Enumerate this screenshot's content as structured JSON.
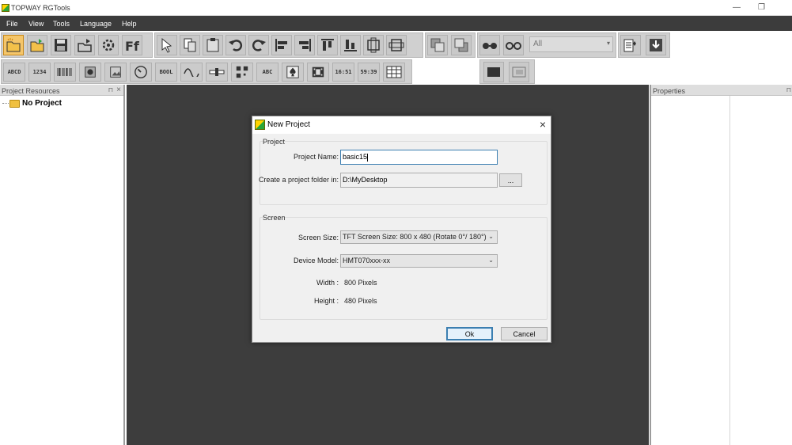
{
  "app": {
    "title": "TOPWAY RGTools",
    "window_controls": {
      "minimize": "—",
      "restore": "❐"
    }
  },
  "menu": [
    {
      "label": "File"
    },
    {
      "label": "View"
    },
    {
      "label": "Tools"
    },
    {
      "label": "Language"
    },
    {
      "label": "Help"
    }
  ],
  "toolbar": {
    "layer_combo_value": "All",
    "small_button_labels": [
      "ABCD",
      "1234",
      "BOOL",
      "16:51",
      "59:39",
      "ABC"
    ]
  },
  "left_panel": {
    "title": "Project Resources",
    "pin": "⊓",
    "close": "×",
    "tree_root": "No Project"
  },
  "right_panel": {
    "title": "Properties",
    "pin": "⊓"
  },
  "dialog": {
    "title": "New Project",
    "close": "×",
    "project_group": "Project",
    "project_name_label": "Project Name:",
    "project_name_value": "basic15",
    "folder_label": "Create a project folder in:",
    "folder_value": "D:\\MyDesktop",
    "browse_label": "...",
    "screen_group": "Screen",
    "screen_size_label": "Screen Size:",
    "screen_size_value": "TFT Screen Size: 800 x 480 (Rotate 0°/ 180°)",
    "device_model_label": "Device Model:",
    "device_model_value": "HMT070xxx-xx",
    "width_label": "Width :",
    "width_value": "800 Pixels",
    "height_label": "Height :",
    "height_value": "480 Pixels",
    "ok_label": "Ok",
    "cancel_label": "Cancel"
  },
  "colors": {
    "menubar_bg": "#3c3c3c",
    "workspace_bg": "#3d3d3d",
    "toolbar_bg": "#d0d0d0",
    "focus_accent": "#3c7fb1"
  }
}
